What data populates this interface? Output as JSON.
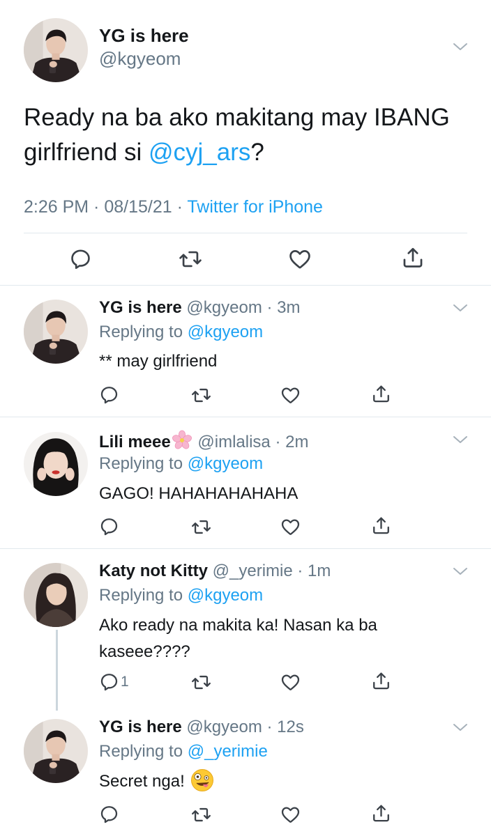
{
  "main_tweet": {
    "display_name": "YG is here",
    "handle": "@kgyeom",
    "text_before": "Ready na ba ako makitang may IBANG girlfriend si ",
    "mention": "@cyj_ars",
    "text_after": "?",
    "time": "2:26 PM · 08/15/21 · ",
    "source": "Twitter for iPhone"
  },
  "replies": [
    {
      "display_name": "YG is here",
      "handle_time": "@kgyeom · 3m",
      "replying_prefix": "Replying to ",
      "replying_to": "@kgyeom",
      "text": "** may girlfriend",
      "reply_count": ""
    },
    {
      "display_name": "Lili meee",
      "name_emoji": "cherry-blossom-emoji",
      "handle_time": "@imlalisa · 2m",
      "replying_prefix": "Replying to ",
      "replying_to": "@kgyeom",
      "text": "GAGO! HAHAHAHAHAHA",
      "reply_count": ""
    },
    {
      "display_name": "Katy not Kitty",
      "handle_time": "@_yerimie · 1m",
      "replying_prefix": "Replying to ",
      "replying_to": "@kgyeom",
      "text": "Ako ready na makita ka! Nasan ka ba kaseee????",
      "reply_count": "1"
    },
    {
      "display_name": "YG is here",
      "handle_time": "@kgyeom · 12s",
      "replying_prefix": "Replying to ",
      "replying_to": "@_yerimie",
      "text": "Secret nga!",
      "text_emoji": "zany-face-emoji",
      "reply_count": ""
    }
  ],
  "icons": {
    "reply": "reply-icon",
    "retweet": "retweet-icon",
    "like": "like-icon",
    "share": "share-icon",
    "more": "chevron-down-icon"
  },
  "colors": {
    "text": "#14171a",
    "secondary": "#657786",
    "accent": "#1da1f2",
    "divider": "#e1e8ed"
  }
}
